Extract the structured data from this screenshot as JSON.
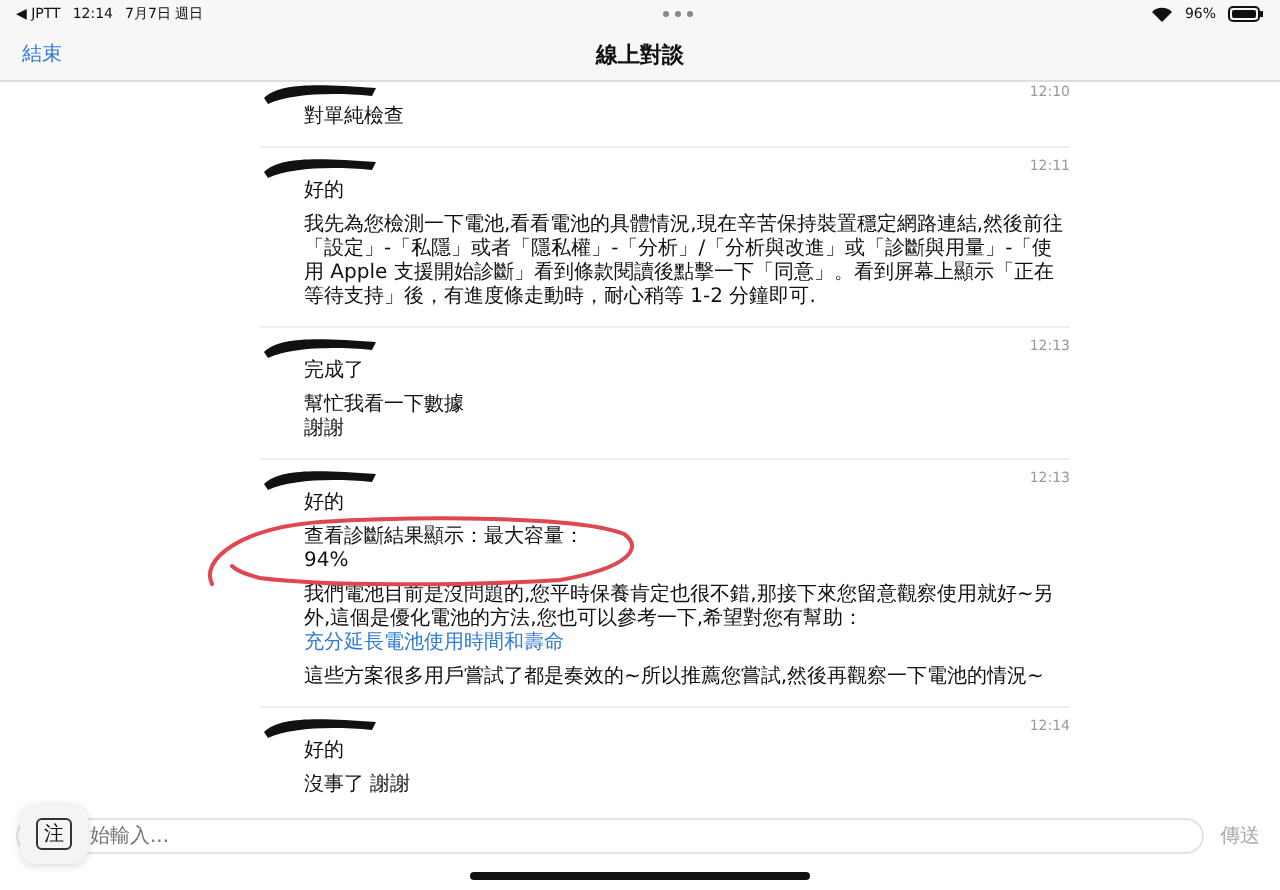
{
  "status_bar": {
    "back_app": "◀ JPTT",
    "time": "12:14",
    "date": "7月7日 週日",
    "battery": "96%"
  },
  "nav": {
    "left": "結束",
    "title": "線上對談"
  },
  "messages": [
    {
      "time": "12:10",
      "lines": [
        {
          "text": "對單純檢查"
        }
      ]
    },
    {
      "time": "12:11",
      "lines": [
        {
          "text": "好的"
        },
        {
          "text": "我先為您檢測一下電池,看看電池的具體情況,現在辛苦保持裝置穩定網路連結,然後前往「設定」-「私隱」或者「隱私權」-「分析」/「分析與改進」或「診斷與用量」-「使用 Apple 支援開始診斷」看到條款閱讀後點擊一下「同意」。看到屏幕上顯示「正在等待支持」後，有進度條走動時，耐心稍等 1-2 分鐘即可."
        }
      ]
    },
    {
      "time": "12:13",
      "lines": [
        {
          "text": "完成了"
        },
        {
          "text": "幫忙我看一下數據",
          "joined": true
        },
        {
          "text": "謝謝"
        }
      ]
    },
    {
      "time": "12:13",
      "annotated": true,
      "lines": [
        {
          "text": "好的"
        },
        {
          "text": "查看診斷結果顯示：最大容量：",
          "joined": true
        },
        {
          "text": "94%"
        },
        {
          "text": "我們電池目前是沒問題的,您平時保養肯定也很不錯,那接下來您留意觀察使用就好~另外,這個是優化電池的方法,您也可以參考一下,希望對您有幫助：",
          "link": "充分延長電池使用時間和壽命"
        },
        {
          "text": "這些方案很多用戶嘗試了都是奏效的~所以推薦您嘗試,然後再觀察一下電池的情況~"
        }
      ]
    },
    {
      "time": "12:14",
      "lines": [
        {
          "text": "好的"
        },
        {
          "text": "沒事了 謝謝"
        }
      ]
    }
  ],
  "input": {
    "placeholder": "始輸入...",
    "key": "注",
    "send": "傳送",
    "send_disabled": true
  }
}
